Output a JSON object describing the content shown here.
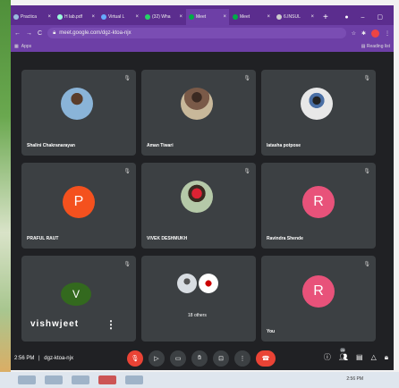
{
  "browser": {
    "tabs": [
      {
        "label": "Practica"
      },
      {
        "label": "H lab.pdf"
      },
      {
        "label": "Virtual L"
      },
      {
        "label": "(32) Wha"
      },
      {
        "label": "Meet",
        "active": true
      },
      {
        "label": "Meet"
      },
      {
        "label": "6.INSUL"
      }
    ],
    "new_tab": "+",
    "url": "meet.google.com/dgz-ktoa-njx",
    "bookmarks_label": "Apps",
    "reading_list": "Reading list"
  },
  "participants": [
    {
      "name": "Shalini Chakranarayan",
      "type": "photo",
      "photo_color": "#8ab4d8"
    },
    {
      "name": "Aman Tiwari",
      "type": "photo",
      "photo_color": "#c8b89a"
    },
    {
      "name": "latasha potpose",
      "type": "photo",
      "photo_color": "#e8e8e8"
    },
    {
      "name": "PRAFUL RAUT",
      "type": "letter",
      "letter": "P",
      "color": "#f4511e"
    },
    {
      "name": "VIVEK DESHMUKH",
      "type": "photo",
      "photo_color": "#b5c9a8"
    },
    {
      "name": "Ravindra Shende",
      "type": "letter",
      "letter": "R",
      "color": "#e8527a"
    },
    {
      "name": "vishwjeet",
      "type": "letter",
      "letter": "V",
      "color": "#33691e"
    },
    {
      "name": "18 others",
      "type": "group"
    },
    {
      "name": "You",
      "type": "letter",
      "letter": "R",
      "color": "#e8527a"
    }
  ],
  "controls": {
    "time": "2:56 PM",
    "separator": "|",
    "meeting_code": "dgz-ktoa-njx",
    "people_count": "26"
  },
  "taskbar": {
    "clock": "2:56 PM"
  }
}
